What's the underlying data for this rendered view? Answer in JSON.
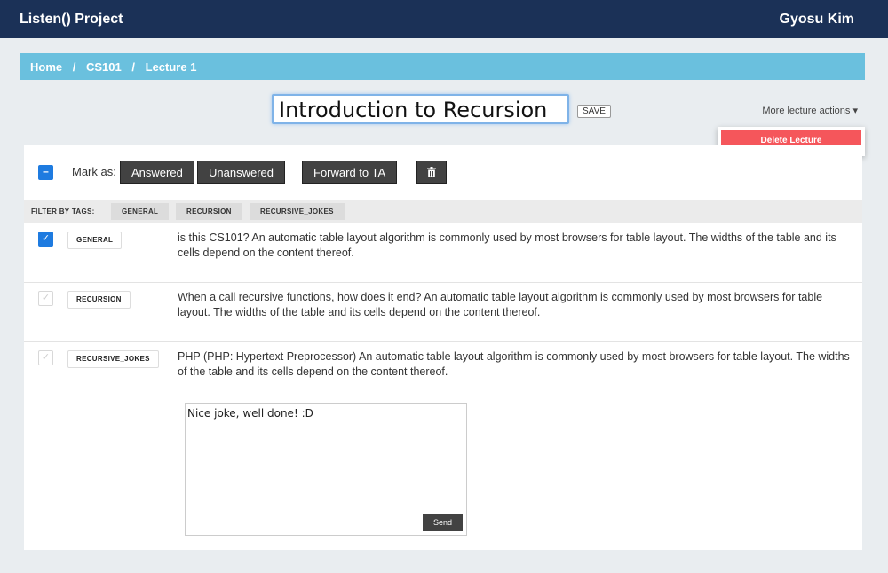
{
  "header": {
    "brand": "Listen() Project",
    "user": "Gyosu Kim"
  },
  "breadcrumb": {
    "items": [
      "Home",
      "CS101",
      "Lecture 1"
    ],
    "separator": "/"
  },
  "lecture": {
    "title": "Introduction to Recursion",
    "save_label": "SAVE",
    "more_actions_label": "More lecture actions ▾",
    "delete_label": "Delete Lecture"
  },
  "toolbar": {
    "mark_as_label": "Mark as:",
    "answered_label": "Answered",
    "unanswered_label": "Unanswered",
    "forward_label": "Forward to TA",
    "trash_icon": "trash-icon",
    "master_check_symbol": "–"
  },
  "filter": {
    "label": "FILTER BY TAGS:",
    "tags": [
      "GENERAL",
      "RECURSION",
      "RECURSIVE_JOKES"
    ]
  },
  "questions": [
    {
      "checked": true,
      "tag": "GENERAL",
      "text": "is this CS101? An automatic table layout algorithm is commonly used by most browsers for table layout. The widths of the table and its cells depend on the content thereof."
    },
    {
      "checked": false,
      "tag": "RECURSION",
      "text": "When a call recursive functions, how does it end? An automatic table layout algorithm is commonly used by most browsers for table layout. The widths of the table and its cells depend on the content thereof."
    },
    {
      "checked": false,
      "tag": "RECURSIVE_JOKES",
      "text": "PHP (PHP: Hypertext Preprocessor) An automatic table layout algorithm is commonly used by most browsers for table layout. The widths of the table and its cells depend on the content thereof."
    }
  ],
  "reply": {
    "text": "Nice joke, well done! :D",
    "send_label": "Send"
  },
  "colors": {
    "topbar": "#1b3157",
    "breadcrumb": "#6ac0de",
    "accent": "#1e7be0",
    "danger": "#f5565b",
    "dark_button": "#424242"
  }
}
